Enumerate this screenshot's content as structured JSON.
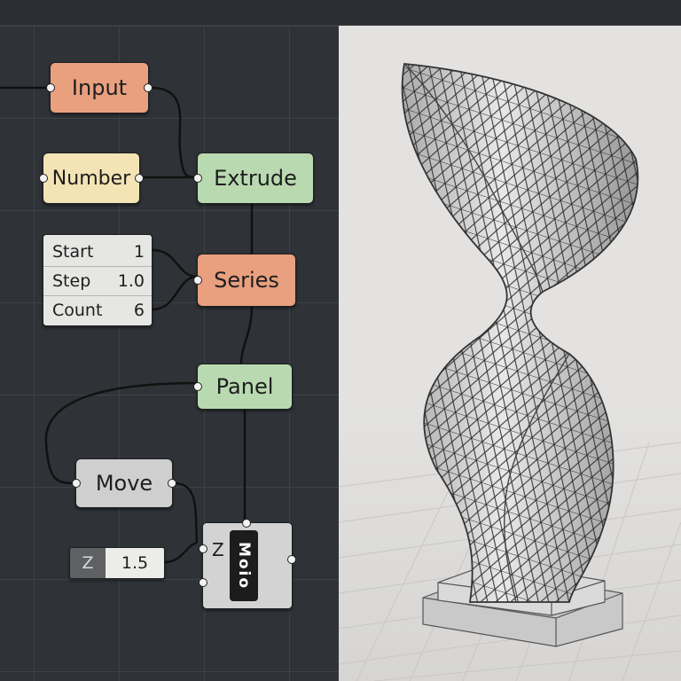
{
  "graph": {
    "input_label": "Input",
    "number_label": "Number",
    "extrude_label": "Extrude",
    "series_label": "Series",
    "panel_label": "Panel",
    "move_label": "Move",
    "params": [
      {
        "name": "Start",
        "value": "1"
      },
      {
        "name": "Step",
        "value": "1.0"
      },
      {
        "name": "Count",
        "value": "6"
      }
    ],
    "z_slider": {
      "label": "Z",
      "value": "1.5"
    },
    "moio": {
      "input_label": "Z",
      "title": "Moio"
    }
  },
  "colors": {
    "input_node": "#e8a07f",
    "number_node": "#f4e3b4",
    "extrude_node": "#b9dab0",
    "series_node": "#e8a07f",
    "panel_node": "#b9dab0",
    "move_node": "#cfcfcf"
  },
  "viewport": {
    "object": "twisted-tower-mesh"
  }
}
